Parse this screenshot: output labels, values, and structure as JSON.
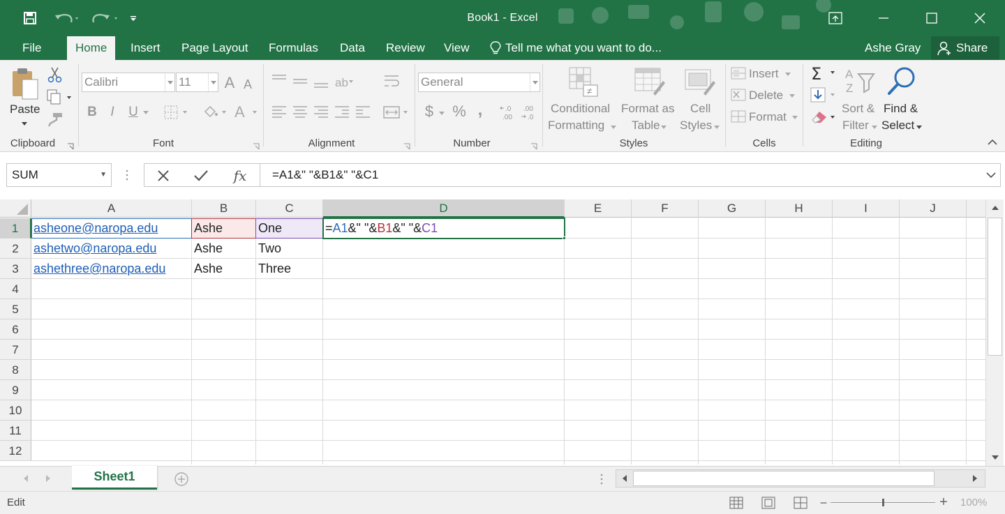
{
  "window": {
    "title": "Book1 - Excel",
    "accent_color": "#217346"
  },
  "quick_access": [
    "save-icon",
    "undo-icon",
    "redo-icon",
    "customize-icon"
  ],
  "tabs": [
    {
      "label": "File"
    },
    {
      "label": "Home",
      "active": true
    },
    {
      "label": "Insert"
    },
    {
      "label": "Page Layout"
    },
    {
      "label": "Formulas"
    },
    {
      "label": "Data"
    },
    {
      "label": "Review"
    },
    {
      "label": "View"
    }
  ],
  "tell_me": "Tell me what you want to do...",
  "user": "Ashe Gray",
  "share_label": "Share",
  "ribbon": {
    "clipboard": {
      "label": "Clipboard",
      "paste": "Paste"
    },
    "font": {
      "label": "Font",
      "name": "Calibri",
      "size": "11",
      "bold": "B",
      "italic": "I",
      "underline": "U"
    },
    "alignment": {
      "label": "Alignment"
    },
    "number": {
      "label": "Number",
      "format": "General",
      "currency": "$",
      "percent": "%",
      "comma": ","
    },
    "styles": {
      "label": "Styles",
      "conditional_1": "Conditional",
      "conditional_2": "Formatting",
      "format_as_1": "Format as",
      "format_as_2": "Table",
      "cell_styles_1": "Cell",
      "cell_styles_2": "Styles"
    },
    "cells": {
      "label": "Cells",
      "insert": "Insert",
      "delete": "Delete",
      "format": "Format"
    },
    "editing": {
      "label": "Editing",
      "sort_1": "Sort &",
      "sort_2": "Filter",
      "find_1": "Find &",
      "find_2": "Select"
    }
  },
  "formula_bar": {
    "name_box": "SUM",
    "fx": "fx",
    "formula": "=A1&\" \"&B1&\" \"&C1"
  },
  "grid": {
    "columns": [
      "A",
      "B",
      "C",
      "D",
      "E",
      "F",
      "G",
      "H",
      "I",
      "J"
    ],
    "rows": [
      "1",
      "2",
      "3",
      "4",
      "5",
      "6",
      "7",
      "8",
      "9",
      "10",
      "11",
      "12"
    ],
    "active_cell": "D1",
    "cells": {
      "A1": "asheone@naropa.edu",
      "A2": "ashetwo@naropa.edu",
      "A3": "ashethree@naropa.edu",
      "B1": "Ashe",
      "B2": "Ashe",
      "B3": "Ashe",
      "C1": "One",
      "C2": "Two",
      "C3": "Three"
    },
    "formula_parts": [
      {
        "text": "=",
        "color": "#222222"
      },
      {
        "text": "A1",
        "color": "#2e6fb7"
      },
      {
        "text": "&\" \"&",
        "color": "#222222"
      },
      {
        "text": "B1",
        "color": "#b4343c"
      },
      {
        "text": "&\" \"&",
        "color": "#222222"
      },
      {
        "text": "C1",
        "color": "#7a4fb1"
      }
    ],
    "ref_colors": {
      "A1": "#2e6fb7",
      "B1": "#b4343c",
      "C1": "#7a4fb1"
    }
  },
  "sheet_tabs": [
    {
      "label": "Sheet1",
      "active": true
    }
  ],
  "status": {
    "mode": "Edit",
    "zoom": "100%"
  }
}
